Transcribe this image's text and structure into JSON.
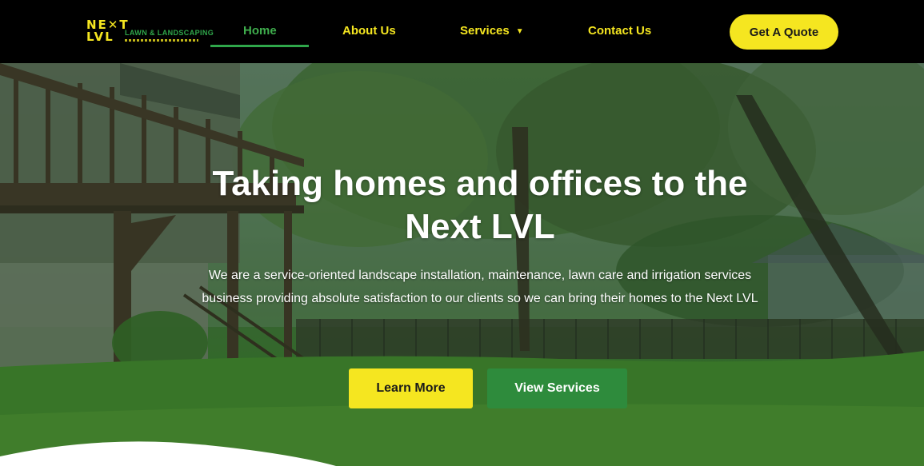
{
  "header": {
    "logo": {
      "mark_line1": "NE✕T",
      "mark_line2": "LVL",
      "text": "LAWN & LANDSCAPING"
    },
    "nav": {
      "home": "Home",
      "about": "About Us",
      "services": "Services",
      "contact": "Contact Us"
    },
    "cta": "Get A Quote"
  },
  "hero": {
    "title": "Taking homes and offices to the Next LVL",
    "subtitle": "We are a service-oriented landscape installation, maintenance, lawn care and irrigation services business providing absolute satisfaction to our clients so we can bring their homes to the Next LVL",
    "buttons": {
      "learn_more": "Learn More",
      "view_services": "View Services"
    }
  },
  "colors": {
    "brand_yellow": "#f5e620",
    "brand_green": "#2e8b3c",
    "header_bg": "#000000"
  },
  "icons": {
    "services_dropdown": "chevron-down-icon"
  }
}
